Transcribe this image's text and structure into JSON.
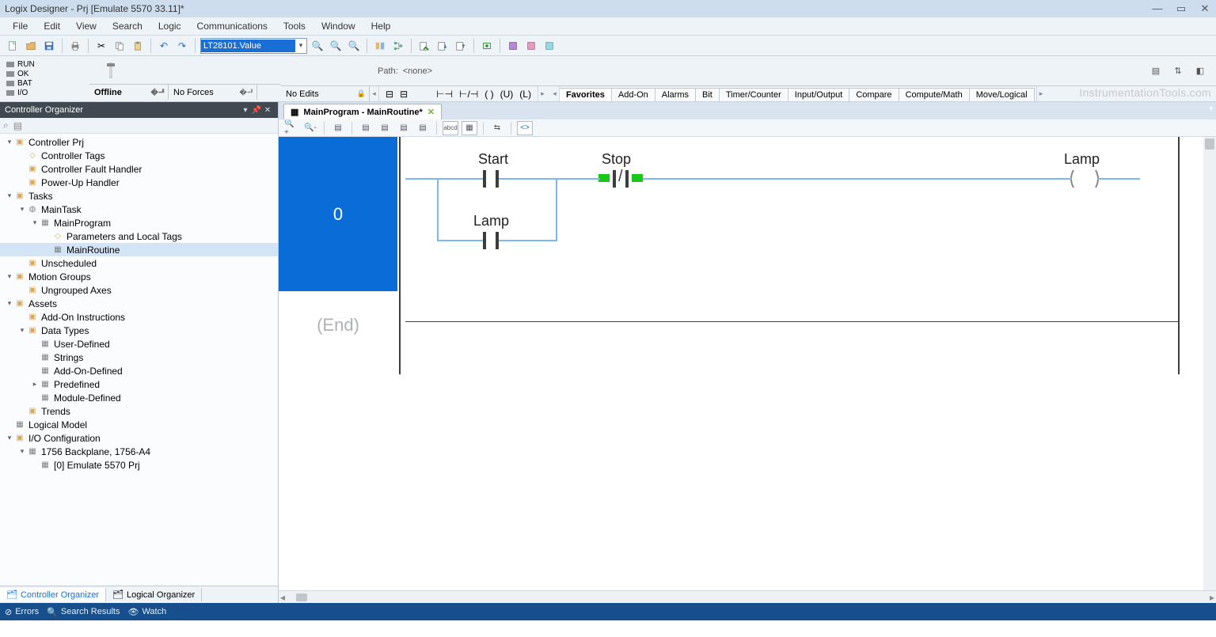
{
  "title": "Logix Designer - Prj [Emulate 5570 33.11]*",
  "menus": [
    "File",
    "Edit",
    "View",
    "Search",
    "Logic",
    "Communications",
    "Tools",
    "Window",
    "Help"
  ],
  "combo_value": "LT28101.Value",
  "status_leds": [
    "RUN",
    "OK",
    "BAT",
    "I/O"
  ],
  "status_cells": {
    "mode": "Offline",
    "forces": "No Forces",
    "edits": "No Edits"
  },
  "path_label": "Path:",
  "path_value": "<none>",
  "instr_tabs": [
    "Favorites",
    "Add-On",
    "Alarms",
    "Bit",
    "Timer/Counter",
    "Input/Output",
    "Compare",
    "Compute/Math",
    "Move/Logical"
  ],
  "watermark": "InstrumentationTools.com",
  "organizer": {
    "title": "Controller Organizer",
    "items": [
      {
        "depth": 0,
        "twist": "▾",
        "icon": "folder",
        "label": "Controller Prj"
      },
      {
        "depth": 1,
        "twist": "",
        "icon": "tag",
        "label": "Controller Tags"
      },
      {
        "depth": 1,
        "twist": "",
        "icon": "folder",
        "label": "Controller Fault Handler"
      },
      {
        "depth": 1,
        "twist": "",
        "icon": "folder",
        "label": "Power-Up Handler"
      },
      {
        "depth": 0,
        "twist": "▾",
        "icon": "folder",
        "label": "Tasks"
      },
      {
        "depth": 1,
        "twist": "▾",
        "icon": "ring",
        "label": "MainTask"
      },
      {
        "depth": 2,
        "twist": "▾",
        "icon": "gear",
        "label": "MainProgram"
      },
      {
        "depth": 3,
        "twist": "",
        "icon": "tag",
        "label": "Parameters and Local Tags"
      },
      {
        "depth": 3,
        "twist": "",
        "icon": "gear",
        "label": "MainRoutine",
        "selected": true
      },
      {
        "depth": 1,
        "twist": "",
        "icon": "folder",
        "label": "Unscheduled"
      },
      {
        "depth": 0,
        "twist": "▾",
        "icon": "folder",
        "label": "Motion Groups"
      },
      {
        "depth": 1,
        "twist": "",
        "icon": "folder",
        "label": "Ungrouped Axes"
      },
      {
        "depth": 0,
        "twist": "▾",
        "icon": "folder",
        "label": "Assets"
      },
      {
        "depth": 1,
        "twist": "",
        "icon": "folder",
        "label": "Add-On Instructions"
      },
      {
        "depth": 1,
        "twist": "▾",
        "icon": "folder",
        "label": "Data Types"
      },
      {
        "depth": 2,
        "twist": "",
        "icon": "gear",
        "label": "User-Defined"
      },
      {
        "depth": 2,
        "twist": "",
        "icon": "gear",
        "label": "Strings"
      },
      {
        "depth": 2,
        "twist": "",
        "icon": "gear",
        "label": "Add-On-Defined"
      },
      {
        "depth": 2,
        "twist": "▸",
        "icon": "gear",
        "label": "Predefined"
      },
      {
        "depth": 2,
        "twist": "",
        "icon": "gear",
        "label": "Module-Defined"
      },
      {
        "depth": 1,
        "twist": "",
        "icon": "folder",
        "label": "Trends"
      },
      {
        "depth": 0,
        "twist": "",
        "icon": "gear",
        "label": "Logical Model"
      },
      {
        "depth": 0,
        "twist": "▾",
        "icon": "folder",
        "label": "I/O Configuration"
      },
      {
        "depth": 1,
        "twist": "▾",
        "icon": "gear",
        "label": "1756 Backplane, 1756-A4"
      },
      {
        "depth": 2,
        "twist": "",
        "icon": "gear",
        "label": "[0] Emulate 5570 Prj"
      }
    ],
    "bottom_tabs": [
      "Controller Organizer",
      "Logical Organizer"
    ]
  },
  "editor": {
    "tab_title": "MainProgram - MainRoutine*",
    "rung_number": "0",
    "end_label": "(End)",
    "labels": {
      "start": "Start",
      "stop": "Stop",
      "lamp_branch": "Lamp",
      "lamp_out": "Lamp"
    }
  },
  "footer": [
    "Errors",
    "Search Results",
    "Watch"
  ]
}
